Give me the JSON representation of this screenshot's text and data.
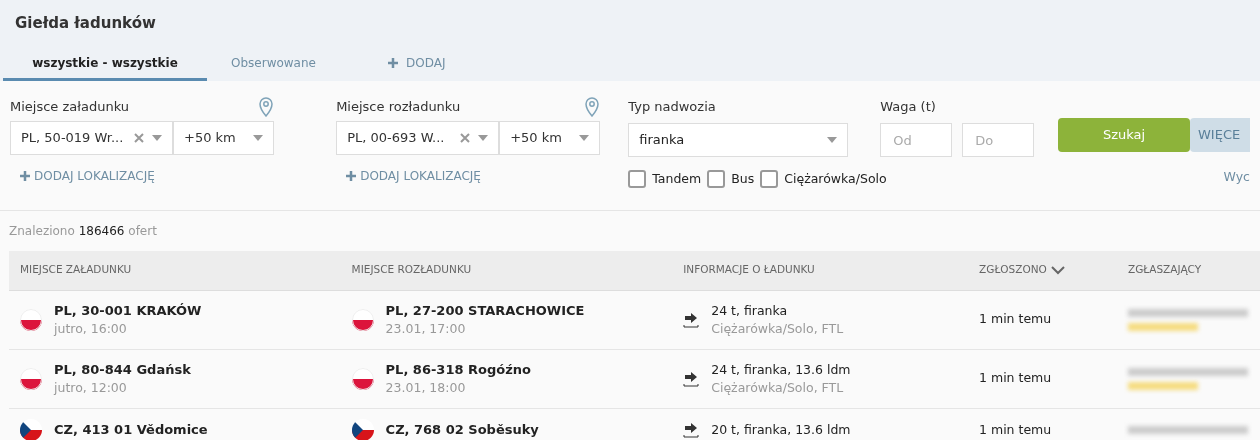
{
  "title": "Giełda ładunków",
  "tabs": [
    {
      "label": "wszystkie - wszystkie",
      "selected": true,
      "kind": "tab"
    },
    {
      "label": "Obserwowane",
      "selected": false,
      "kind": "tab"
    },
    {
      "label": "DODAJ",
      "selected": false,
      "kind": "add"
    }
  ],
  "loading": {
    "label": "Miejsce załadunku",
    "value": "PL, 50-019 Wr...",
    "radius": "+50 km",
    "add": "DODAJ LOKALIZACJĘ"
  },
  "unloading": {
    "label": "Miejsce rozładunku",
    "value": "PL, 00-693 W...",
    "radius": "+50 km",
    "add": "DODAJ LOKALIZACJĘ"
  },
  "body": {
    "label": "Typ nadwozia",
    "value": "firanka"
  },
  "weight": {
    "label": "Waga (t)",
    "from_placeholder": "Od",
    "to_placeholder": "Do"
  },
  "checkboxes": [
    {
      "label": "Tandem",
      "checked": false
    },
    {
      "label": "Bus",
      "checked": false
    },
    {
      "label": "Ciężarówka/Solo",
      "checked": false
    }
  ],
  "search_button": "Szukaj",
  "more_button": "WIĘCE",
  "clear_link": "Wyc",
  "count": {
    "prefix": "Znaleziono",
    "number": "186466",
    "suffix": "ofert"
  },
  "columns": [
    "MIEJSCE ZAŁADUNKU",
    "MIEJSCE ROZŁADUNKU",
    "INFORMACJE O ŁADUNKU",
    "ZGŁOSZONO",
    "ZGŁASZAJĄCY"
  ],
  "rows": [
    {
      "from": {
        "kind": "pl",
        "place": "PL, 30-001 KRAKÓW",
        "date": "jutro, 16:00"
      },
      "to": {
        "kind": "pl",
        "place": "PL, 27-200 STARACHOWICE",
        "date": "23.01, 17:00"
      },
      "info": "24 t, firanka",
      "info_sub": "Ciężarówka/Solo, FTL",
      "time": "1 min temu"
    },
    {
      "from": {
        "kind": "pl",
        "place": "PL, 80-844 Gdańsk",
        "date": "jutro, 12:00"
      },
      "to": {
        "kind": "pl",
        "place": "PL, 86-318 Rogóźno",
        "date": "23.01, 18:00"
      },
      "info": "24 t, firanka, 13.6 ldm",
      "info_sub": "Ciężarówka/Solo, FTL",
      "time": "1 min temu"
    },
    {
      "from": {
        "kind": "cz",
        "place": "CZ, 413 01 Vědomice"
      },
      "to": {
        "kind": "cz",
        "place": "CZ, 768 02 Soběsuky"
      },
      "info": "20 t, firanka, 13.6 ldm",
      "time": "1 min temu"
    }
  ]
}
